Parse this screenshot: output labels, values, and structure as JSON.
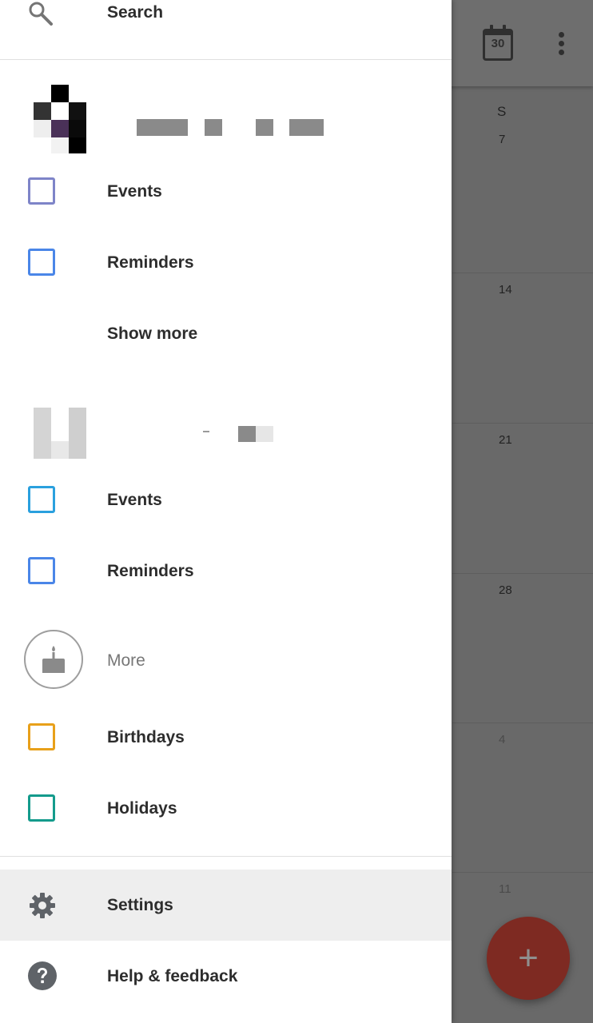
{
  "drawer": {
    "search_label": "Search",
    "account1": {
      "items": [
        {
          "label": "Events",
          "color": "#7e84c8"
        },
        {
          "label": "Reminders",
          "color": "#4a86e8"
        }
      ],
      "show_more_label": "Show more"
    },
    "account2": {
      "items": [
        {
          "label": "Events",
          "color": "#2aa0de"
        },
        {
          "label": "Reminders",
          "color": "#4a86e8"
        }
      ]
    },
    "more_section": {
      "label": "More",
      "icon": "birthday-cake-icon"
    },
    "other_calendars": [
      {
        "label": "Birthdays",
        "color": "#e8a01a"
      },
      {
        "label": "Holidays",
        "color": "#149b8c"
      }
    ],
    "settings_label": "Settings",
    "help_label": "Help & feedback"
  },
  "background_calendar": {
    "today_icon_number": "30",
    "day_header": "S",
    "dates": [
      "7",
      "14",
      "21",
      "28",
      "4",
      "11"
    ],
    "fab_icon": "plus-icon"
  }
}
